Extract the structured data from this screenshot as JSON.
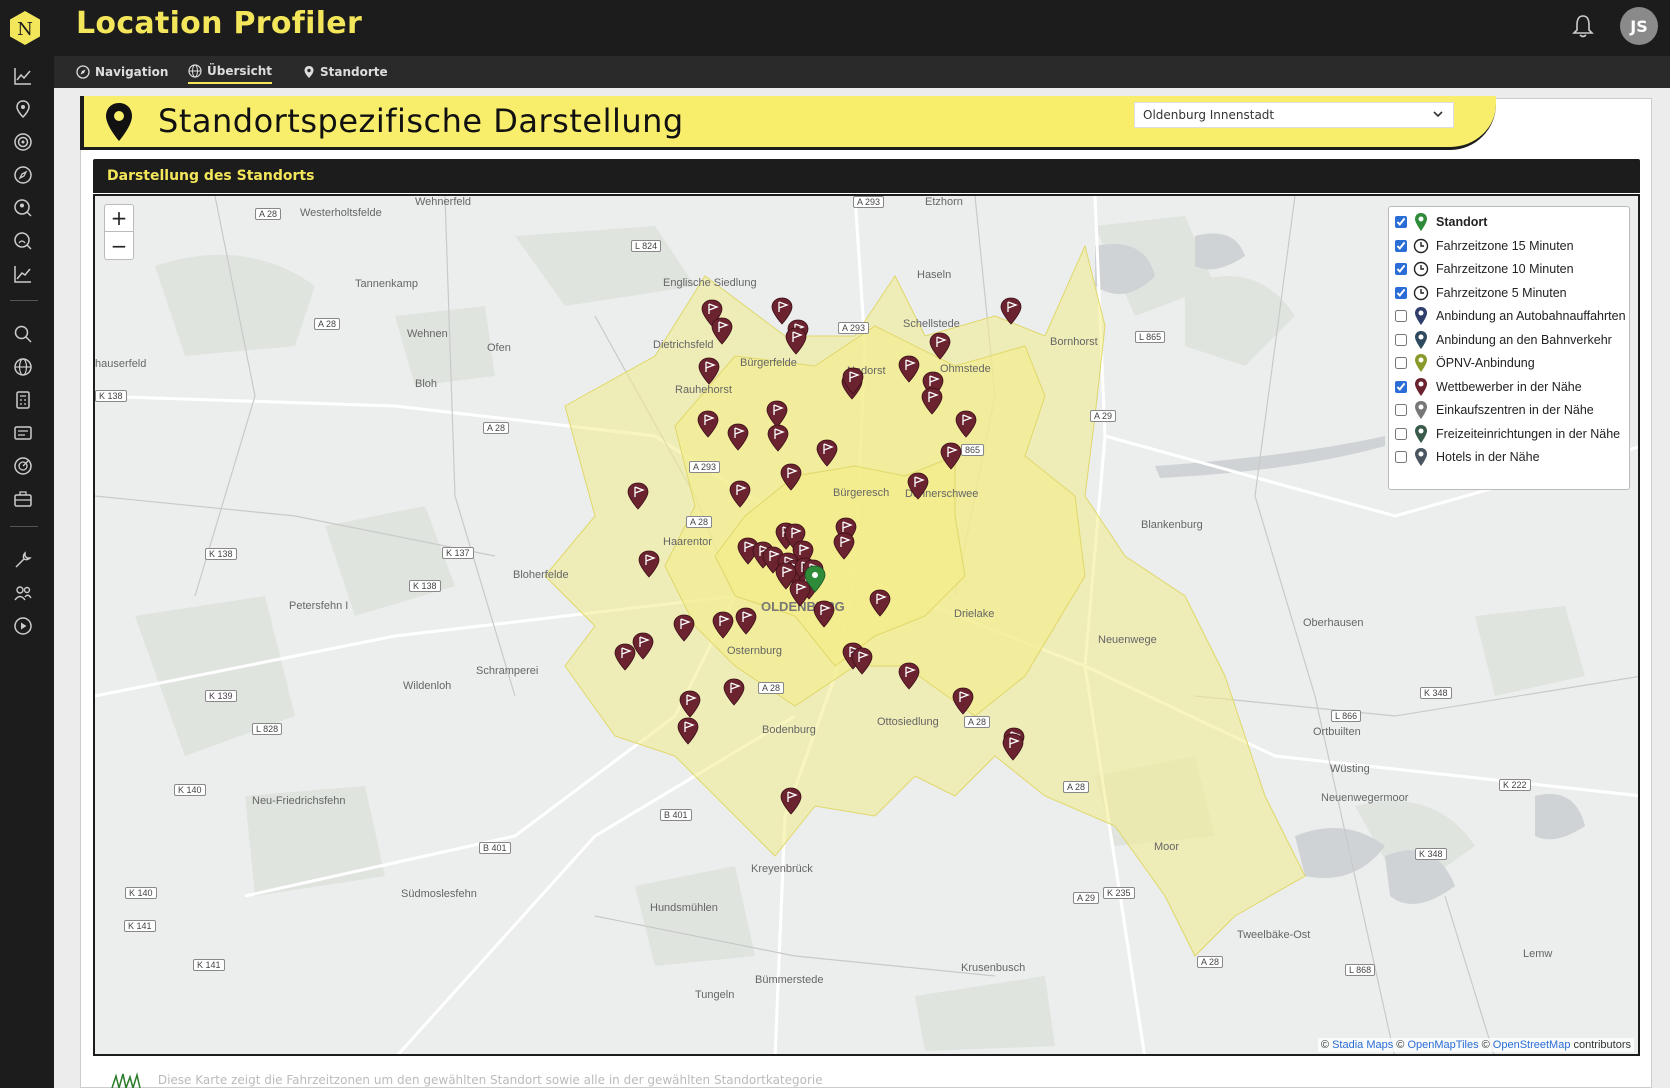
{
  "app": {
    "title": "Location Profiler",
    "logo_letter": "N",
    "user_initials": "JS"
  },
  "tabs": [
    {
      "label": "Navigation",
      "icon": "compass-icon"
    },
    {
      "label": "Übersicht",
      "icon": "globe-icon",
      "active": true
    },
    {
      "label": "Standorte",
      "icon": "pin-icon"
    }
  ],
  "banner": {
    "title": "Standortspezifische Darstellung",
    "selected_location": "Oldenburg Innenstadt"
  },
  "panel": {
    "title": "Darstellung des Standorts"
  },
  "map": {
    "zoom_in": "+",
    "zoom_out": "−",
    "attribution_stadia": "Stadia Maps",
    "attribution_omt": "OpenMapTiles",
    "attribution_osm": "OpenStreetMap",
    "attribution_suffix": "contributors",
    "place_labels": [
      "Wehnerfeld",
      "Etzhorn",
      "Westerholtsfelde",
      "Tannenkamp",
      "Englische Siedlung",
      "Haseln",
      "Schellstede",
      "Bornhorst",
      "Wehnen",
      "Ofen",
      "Dietrichsfeld",
      "Bürgerfelde",
      "Nadorst",
      "Ohmstede",
      "hauserfeld",
      "Bloh",
      "Rauhehorst",
      "Bürgeresch",
      "Donnerschwee",
      "Haarentor",
      "Bloherfelde",
      "OLDENBURG",
      "Drielake",
      "Petersfehn I",
      "Neuenwege",
      "Schramperei",
      "Wildenloh",
      "Osternburg",
      "Ottosiedlung",
      "Bodenburg",
      "Krusenbusch",
      "Blankenburg",
      "Oberhausen",
      "Ortbuilten",
      "Wüsting",
      "Neuenwegermoor",
      "Neu-Friedrichsfehn",
      "Kreyenbrück",
      "Südmoslesfehn",
      "Hundsmühlen",
      "Tweelbäke-Ost",
      "Bümmerstede",
      "Tungeln",
      "Moor",
      "Lemw"
    ],
    "road_labels": [
      "A 28",
      "A 293",
      "L 824",
      "A 28",
      "A 293",
      "L 865",
      "K 138",
      "A 28",
      "A 29",
      "A 293",
      "A 28",
      "K 138",
      "K 137",
      "K 138",
      "K 139",
      "L 828",
      "K 140",
      "B 401",
      "B 401",
      "K 140",
      "K 141",
      "K 141",
      "L 866",
      "K 348",
      "A 28",
      "A 28",
      "K 222",
      "K 348",
      "A 29",
      "K 235",
      "A 28",
      "L 868",
      "865",
      "A 28"
    ]
  },
  "legend": [
    {
      "label": "Standort",
      "checked": true,
      "bold": true,
      "icon": "standort-pin-icon",
      "color": "#2e8b3a"
    },
    {
      "label": "Fahrzeitzone 15 Minuten",
      "checked": true,
      "icon": "clock-icon"
    },
    {
      "label": "Fahrzeitzone 10 Minuten",
      "checked": true,
      "icon": "clock-icon"
    },
    {
      "label": "Fahrzeitzone 5 Minuten",
      "checked": true,
      "icon": "clock-icon"
    },
    {
      "label": "Anbindung an Autobahnauffahrten",
      "checked": false,
      "icon": "highway-pin-icon",
      "color": "#2f3e6b"
    },
    {
      "label": "Anbindung an den Bahnverkehr",
      "checked": false,
      "icon": "train-pin-icon",
      "color": "#2f4a5e"
    },
    {
      "label": "ÖPNV-Anbindung",
      "checked": false,
      "icon": "bus-pin-icon",
      "color": "#8a9a2a"
    },
    {
      "label": "Wettbewerber in der Nähe",
      "checked": true,
      "icon": "competitor-pin-icon",
      "color": "#6b2330"
    },
    {
      "label": "Einkaufszentren in der Nähe",
      "checked": false,
      "icon": "shopping-pin-icon",
      "color": "#777777"
    },
    {
      "label": "Freizeiteinrichtungen in der Nähe",
      "checked": false,
      "icon": "leisure-pin-icon",
      "color": "#3a5a4a"
    },
    {
      "label": "Hotels in der Nähe",
      "checked": false,
      "icon": "hotel-pin-icon",
      "color": "#4a5560"
    }
  ],
  "colors": {
    "accent": "#f4e65a",
    "dark": "#1c1c1c",
    "zone": "#f3ec8a",
    "competitor": "#6b2330"
  },
  "footer": {
    "text": "Diese Karte zeigt die Fahrzeitzonen um den gewählten Standort sowie alle in der gewählten Standortkategorie"
  }
}
